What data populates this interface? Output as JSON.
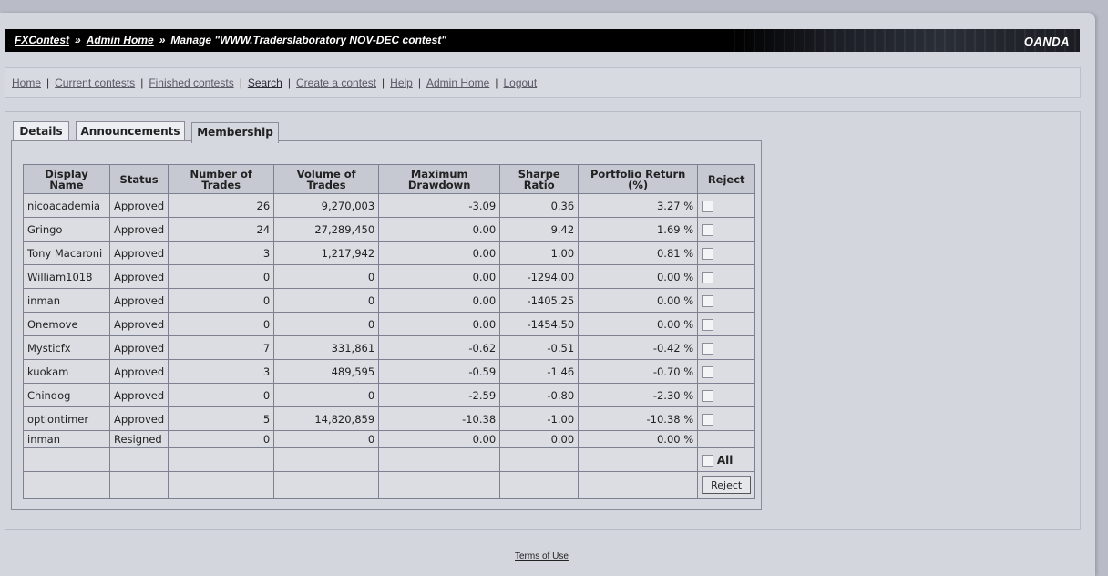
{
  "header": {
    "crumb_home": "FXContest",
    "crumb_admin": "Admin Home",
    "crumb_current": "Manage \"WWW.Traderslaboratory NOV-DEC contest\"",
    "separator": "»",
    "logo": "OANDA"
  },
  "nav": {
    "items": [
      {
        "label": "Home"
      },
      {
        "label": "Current contests"
      },
      {
        "label": "Finished contests"
      },
      {
        "label": "Search"
      },
      {
        "label": "Create a contest"
      },
      {
        "label": "Help"
      },
      {
        "label": "Admin Home"
      },
      {
        "label": "Logout"
      }
    ],
    "separator": "|"
  },
  "tabs": [
    {
      "label": "Details"
    },
    {
      "label": "Announcements"
    },
    {
      "label": "Membership"
    }
  ],
  "table": {
    "headers": [
      "Display Name",
      "Status",
      "Number of Trades",
      "Volume of Trades",
      "Maximum Drawdown",
      "Sharpe Ratio",
      "Portfolio Return (%)",
      "Reject"
    ],
    "rows": [
      {
        "name": "nicoacademia",
        "status": "Approved",
        "trades": "26",
        "volume": "9,270,003",
        "drawdown": "-3.09",
        "sharpe": "0.36",
        "return": "3.27 %"
      },
      {
        "name": "Gringo",
        "status": "Approved",
        "trades": "24",
        "volume": "27,289,450",
        "drawdown": "0.00",
        "sharpe": "9.42",
        "return": "1.69 %"
      },
      {
        "name": "Tony Macaroni",
        "status": "Approved",
        "trades": "3",
        "volume": "1,217,942",
        "drawdown": "0.00",
        "sharpe": "1.00",
        "return": "0.81 %"
      },
      {
        "name": "William1018",
        "status": "Approved",
        "trades": "0",
        "volume": "0",
        "drawdown": "0.00",
        "sharpe": "-1294.00",
        "return": "0.00 %"
      },
      {
        "name": "inman",
        "status": "Approved",
        "trades": "0",
        "volume": "0",
        "drawdown": "0.00",
        "sharpe": "-1405.25",
        "return": "0.00 %"
      },
      {
        "name": "Onemove",
        "status": "Approved",
        "trades": "0",
        "volume": "0",
        "drawdown": "0.00",
        "sharpe": "-1454.50",
        "return": "0.00 %"
      },
      {
        "name": "Mysticfx",
        "status": "Approved",
        "trades": "7",
        "volume": "331,861",
        "drawdown": "-0.62",
        "sharpe": "-0.51",
        "return": "-0.42 %"
      },
      {
        "name": "kuokam",
        "status": "Approved",
        "trades": "3",
        "volume": "489,595",
        "drawdown": "-0.59",
        "sharpe": "-1.46",
        "return": "-0.70 %"
      },
      {
        "name": "Chindog",
        "status": "Approved",
        "trades": "0",
        "volume": "0",
        "drawdown": "-2.59",
        "sharpe": "-0.80",
        "return": "-2.30 %"
      },
      {
        "name": "optiontimer",
        "status": "Approved",
        "trades": "5",
        "volume": "14,820,859",
        "drawdown": "-10.38",
        "sharpe": "-1.00",
        "return": "-10.38 %"
      }
    ],
    "resigned_row": {
      "name": "inman",
      "status": "Resigned",
      "trades": "0",
      "volume": "0",
      "drawdown": "0.00",
      "sharpe": "0.00",
      "return": "0.00 %"
    },
    "all_label": "All",
    "reject_button": "Reject"
  },
  "footer": {
    "terms": "Terms of Use"
  }
}
